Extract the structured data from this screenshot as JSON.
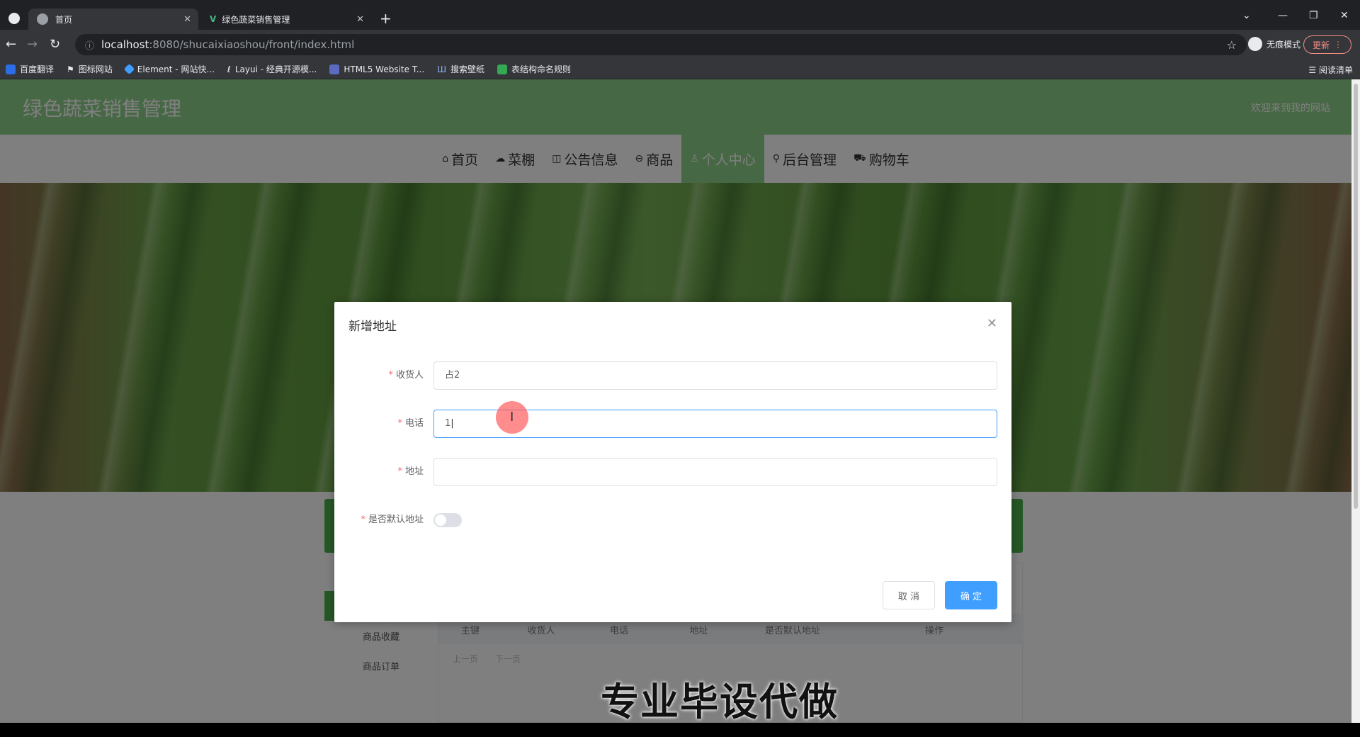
{
  "browser": {
    "tabs": [
      {
        "label": "首页",
        "active": true
      },
      {
        "label": "绿色蔬菜销售管理",
        "active": false
      }
    ],
    "new_tab": "+",
    "url_host": "localhost",
    "url_path": ":8080/shucaixiaoshou/front/index.html",
    "incognito_label": "无痕模式",
    "update_label": "更新",
    "bookmarks": [
      {
        "label": "百度翻译",
        "color": "#2b6de5"
      },
      {
        "label": "图标网站",
        "color": "#e8eaed"
      },
      {
        "label": "Element - 网站快...",
        "color": "#409eff"
      },
      {
        "label": "Layui - 经典开源模...",
        "color": "#e8eaed"
      },
      {
        "label": "HTML5 Website T...",
        "color": "#5c6bc0"
      },
      {
        "label": "搜索壁纸",
        "color": "#3f51b5"
      },
      {
        "label": "表结构命名规则",
        "color": "#34a853"
      }
    ],
    "reading_list": "阅读清单"
  },
  "site": {
    "title": "绿色蔬菜销售管理",
    "welcome": "欢迎来到我的网站",
    "nav": [
      {
        "label": "首页",
        "icon": "home-icon",
        "glyph": "⌂",
        "active": false
      },
      {
        "label": "菜棚",
        "icon": "cloud-icon",
        "glyph": "☁",
        "active": false
      },
      {
        "label": "公告信息",
        "icon": "book-icon",
        "glyph": "◫",
        "active": false
      },
      {
        "label": "商品",
        "icon": "goods-icon",
        "glyph": "⊖",
        "active": false
      },
      {
        "label": "个人中心",
        "icon": "user-icon",
        "glyph": "♙",
        "active": true
      },
      {
        "label": "后台管理",
        "icon": "link-icon",
        "glyph": "⚲",
        "active": false
      },
      {
        "label": "购物车",
        "icon": "cart-icon",
        "glyph": "⛟",
        "active": false
      }
    ]
  },
  "background_page": {
    "side_menu": [
      "商品收藏",
      "商品订单"
    ],
    "table_headers": [
      "主键",
      "收货人",
      "电话",
      "地址",
      "是否默认地址",
      "操作"
    ],
    "pager": [
      "上一页",
      "下一页"
    ]
  },
  "dialog": {
    "title": "新增地址",
    "fields": {
      "receiver": {
        "label": "收货人",
        "value": "占2"
      },
      "phone": {
        "label": "电话",
        "value": "1"
      },
      "address": {
        "label": "地址",
        "value": ""
      },
      "default": {
        "label": "是否默认地址",
        "checked": false
      }
    },
    "cancel_label": "取 消",
    "ok_label": "确 定"
  },
  "watermark": "专业毕设代做"
}
